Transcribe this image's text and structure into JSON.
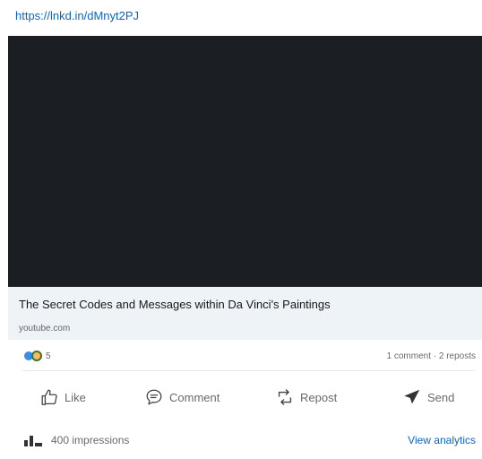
{
  "post": {
    "link_text": "https://lnkd.in/dMnyt2PJ"
  },
  "preview": {
    "title": "The Secret Codes and Messages within Da Vinci's Paintings",
    "source": "youtube.com"
  },
  "social": {
    "reaction_count": "5",
    "comments_reposts": "1 comment · 2 reposts",
    "reaction_icons": [
      "like-reaction-icon",
      "celebrate-reaction-icon"
    ]
  },
  "actions": {
    "like": "Like",
    "comment": "Comment",
    "repost": "Repost",
    "send": "Send"
  },
  "footer": {
    "impressions": "400 impressions",
    "analytics": "View analytics"
  },
  "colors": {
    "link": "#0a66c2",
    "media_background": "#1b1f23",
    "preview_background": "#eef3f8",
    "like_reaction": "#378fe9",
    "celebrate_reaction": "#f5bb5c"
  }
}
